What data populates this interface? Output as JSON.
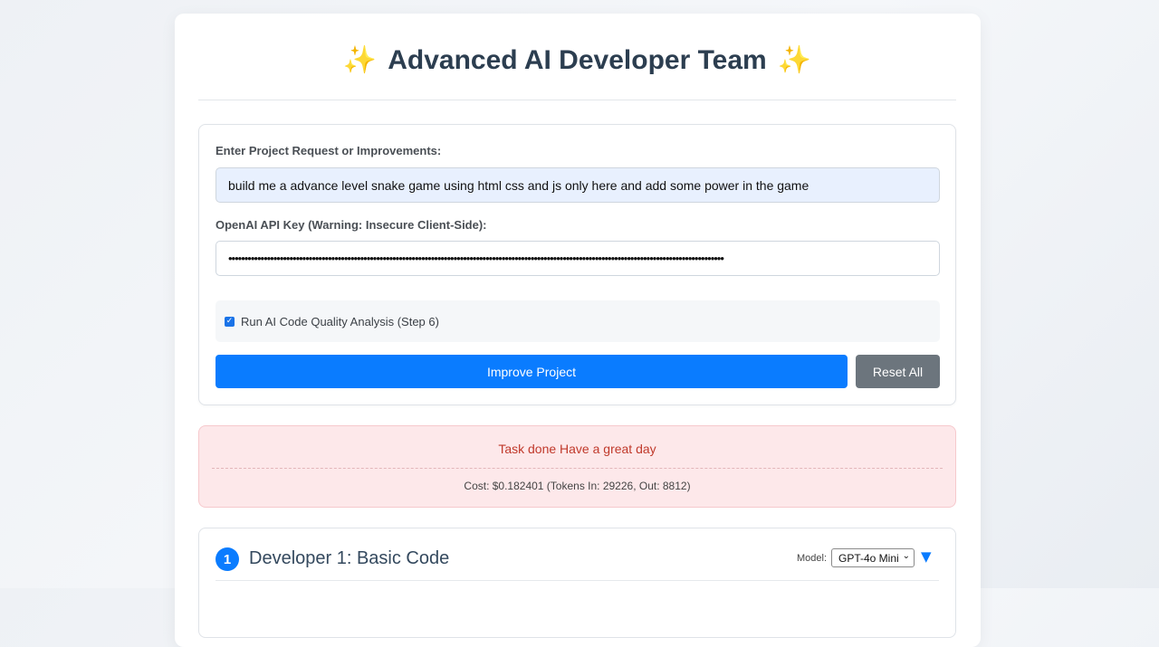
{
  "header": {
    "title": "Advanced AI Developer Team",
    "sparkle_glyph": "✨"
  },
  "form": {
    "request_label": "Enter Project Request or Improvements:",
    "request_value": "build me a advance level snake game using html css and js only here and add some power in the game",
    "apikey_label": "OpenAI API Key (Warning: Insecure Client-Side):",
    "apikey_value": "••••••••••••••••••••••••••••••••••••••••••••••••••••••••••••••••••••••••••••••••••••••••••••••••••••••••••••••••••••••••••••••••••••••••••••••••••••••••••",
    "quality_check_label": "Run AI Code Quality Analysis (Step 6)",
    "quality_check_checked": true,
    "improve_button": "Improve Project",
    "reset_button": "Reset All"
  },
  "status": {
    "message": "Task done Have a great day",
    "cost": "Cost: $0.182401 (Tokens In: 29226, Out: 8812)"
  },
  "developers": [
    {
      "number": "1",
      "title": "Developer 1: Basic Code",
      "model_label": "Model:",
      "model_selected": "GPT-4o Mini"
    }
  ],
  "colors": {
    "primary": "#0a7cff",
    "secondary": "#6c757d",
    "error_bg": "#fde8ea",
    "error_text": "#c0392b"
  },
  "icons": {
    "checkbox": "checkmark",
    "toggle": "triangle-down"
  }
}
